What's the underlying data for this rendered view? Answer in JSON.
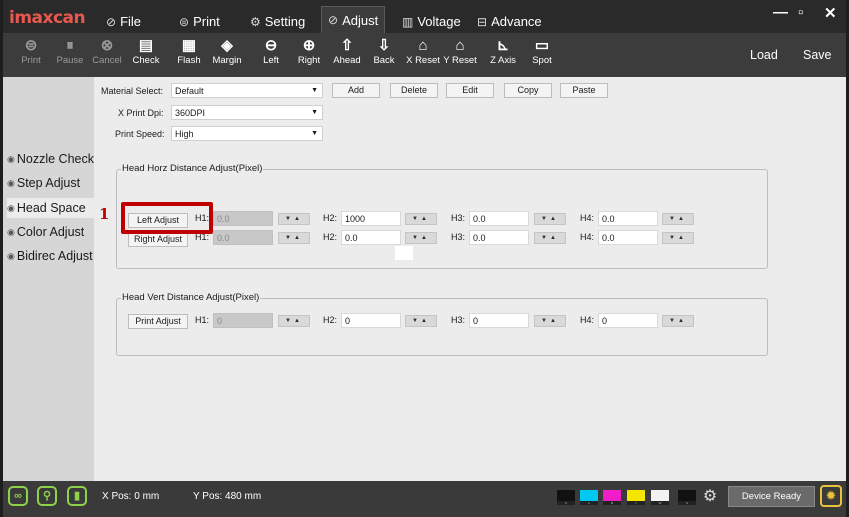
{
  "app": {
    "logo": "imaxcan"
  },
  "menu": {
    "file": "File",
    "print": "Print",
    "setting": "Setting",
    "adjust": "Adjust",
    "voltage": "Voltage",
    "advance": "Advance"
  },
  "window_controls": {
    "minimize": "—",
    "maximize": "▫",
    "close": "✕"
  },
  "toolbar": {
    "print": "Print",
    "pause": "Pause",
    "cancel": "Cancel",
    "check": "Check",
    "flash": "Flash",
    "margin": "Margin",
    "left": "Left",
    "right": "Right",
    "ahead": "Ahead",
    "back": "Back",
    "x_reset": "X Reset",
    "y_reset": "Y Reset",
    "z_axis": "Z Axis",
    "spot": "Spot",
    "load": "Load",
    "save": "Save"
  },
  "sidebar": {
    "nozzle_check": "Nozzle Check",
    "step_adjust": "Step Adjust",
    "head_space": "Head Space",
    "color_adjust": "Color Adjust",
    "bidirec_adjust": "Bidirec Adjust"
  },
  "settings": {
    "material_label": "Material Select:",
    "material_value": "Default",
    "dpi_label": "X Print Dpi:",
    "dpi_value": "360DPI",
    "speed_label": "Print Speed:",
    "speed_value": "High",
    "add": "Add",
    "delete": "Delete",
    "edit": "Edit",
    "copy": "Copy",
    "paste": "Paste"
  },
  "horz": {
    "title": "Head Horz Distance Adjust(Pixel)",
    "left_adjust": "Left Adjust",
    "right_adjust": "Right Adjust",
    "h1": "H1:",
    "h2": "H2:",
    "h3": "H3:",
    "h4": "H4:",
    "left": {
      "h1": "0.0",
      "h2": "1000",
      "h3": "0.0",
      "h4": "0.0"
    },
    "right": {
      "h1": "0.0",
      "h2": "0.0",
      "h3": "0.0",
      "h4": "0.0"
    }
  },
  "vert": {
    "title": "Head Vert Distance Adjust(Pixel)",
    "print_adjust": "Print Adjust",
    "h1": "H1:",
    "h2": "H2:",
    "h3": "H3:",
    "h4": "H4:",
    "values": {
      "h1": "0",
      "h2": "0",
      "h3": "0",
      "h4": "0"
    }
  },
  "spinner_glyph": "▼▲",
  "annotation": "1",
  "status": {
    "x_pos": "X Pos: 0 mm",
    "y_pos": "Y Pos: 480 mm",
    "device_ready": "Device Ready",
    "inks": [
      {
        "letter": "K",
        "color": "#111111"
      },
      {
        "letter": "C",
        "color": "#00c8f0"
      },
      {
        "letter": "M",
        "color": "#f01ec8"
      },
      {
        "letter": "Y",
        "color": "#f5e600"
      },
      {
        "letter": "W",
        "color": "#f2f2f2"
      },
      {
        "letter": "S",
        "color": "#111111"
      }
    ]
  },
  "colors": {
    "highlight": "#c00000",
    "status_icon": "#8ed24a",
    "bulb": "#e8c23a"
  }
}
